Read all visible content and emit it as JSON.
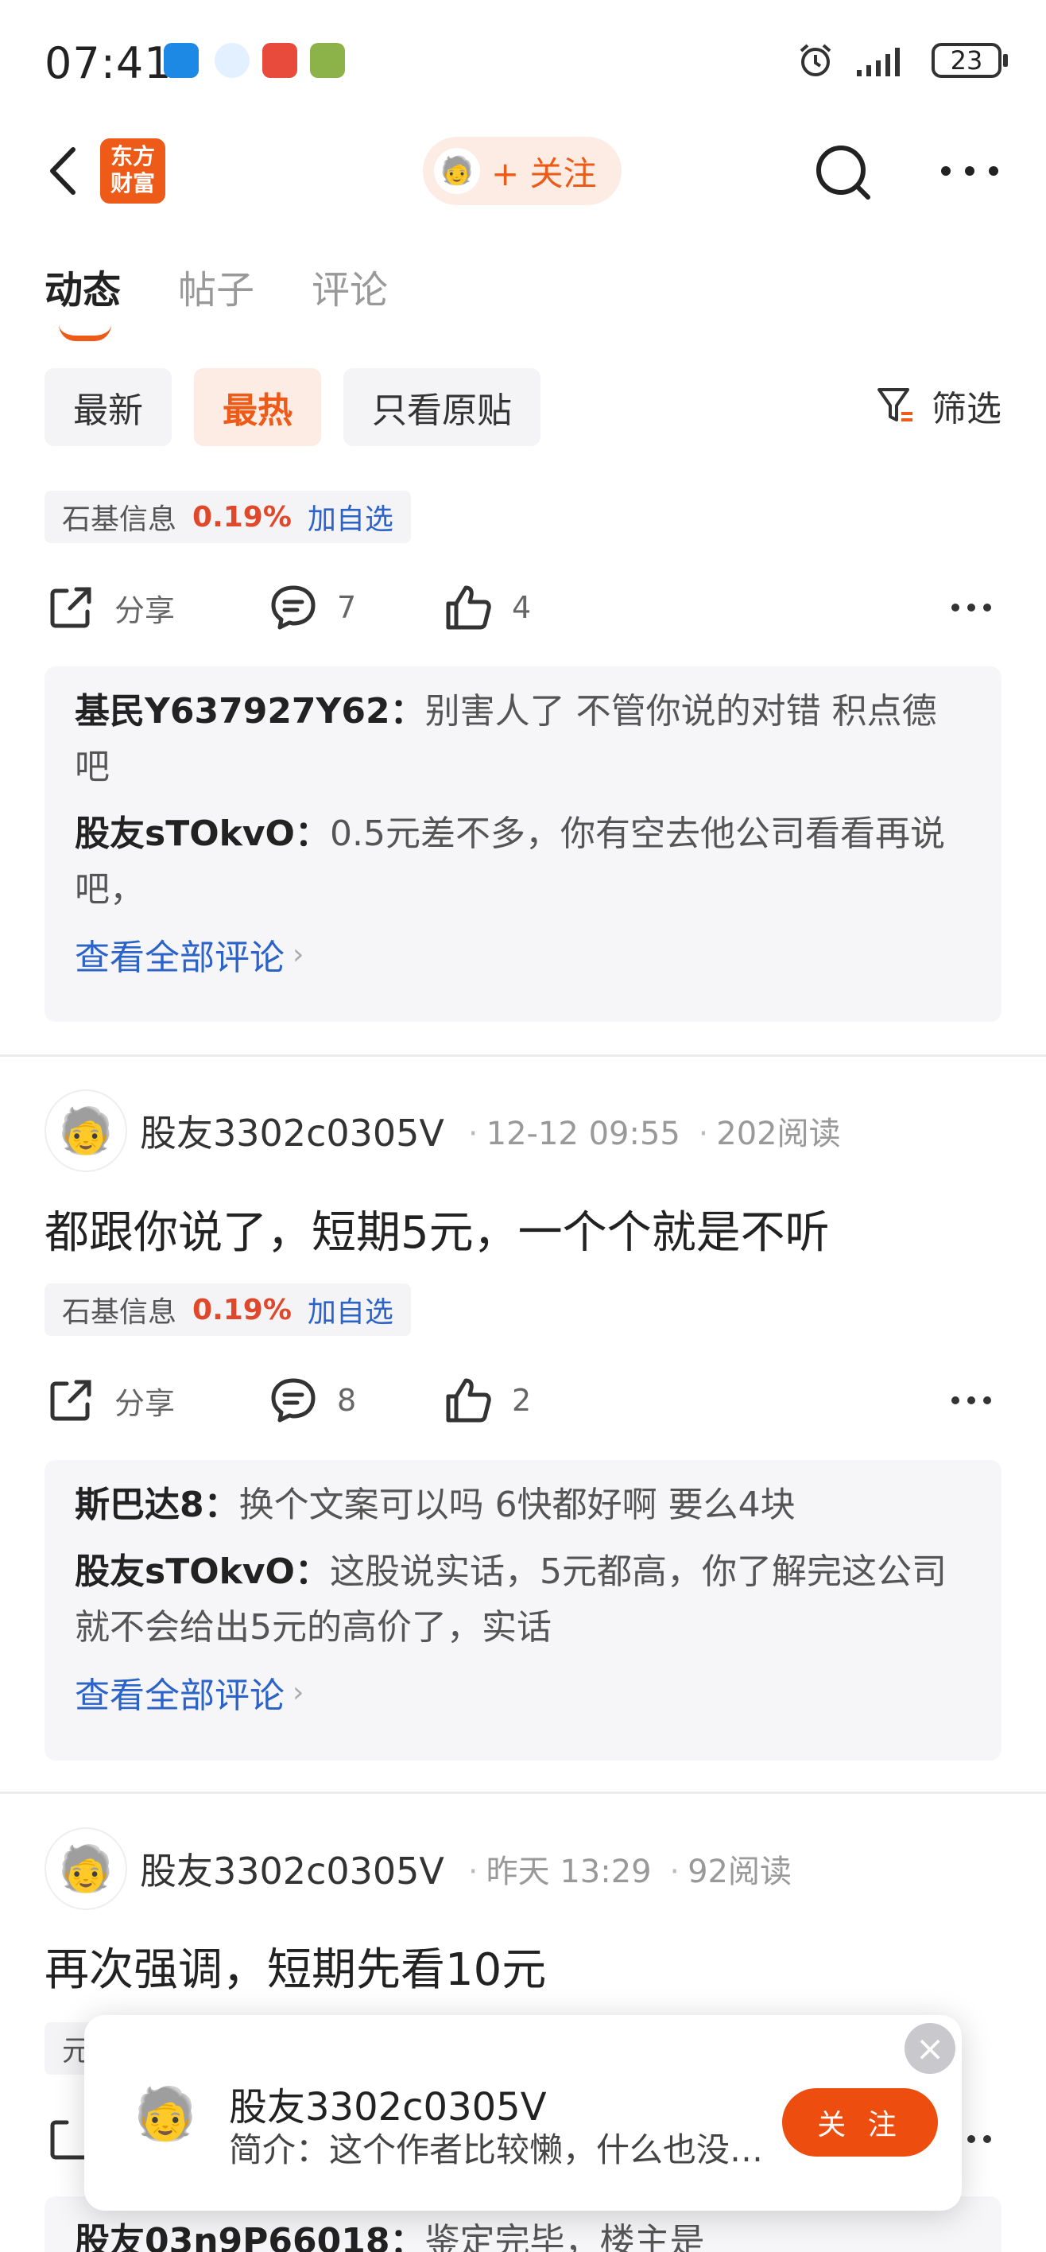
{
  "status_bar": {
    "time": "07:41",
    "battery": "23"
  },
  "nav": {
    "logo_text_1": "东方",
    "logo_text_2": "财富",
    "follow_label": "+ 关注"
  },
  "tabs": [
    {
      "label": "动态"
    },
    {
      "label": "帖子"
    },
    {
      "label": "评论"
    }
  ],
  "filters": {
    "items": [
      "最新",
      "最热",
      "只看原贴"
    ],
    "active": "最热",
    "filter_label": "筛选"
  },
  "posts": [
    {
      "stock": {
        "name": "石基信息",
        "change": "0.19%",
        "add": "加自选"
      },
      "actions": {
        "share": "分享",
        "comments": "7",
        "likes": "4"
      },
      "comments": [
        {
          "user": "基民Y637927Y62：",
          "text": "别害人了 不管你说的对错 积点德吧"
        },
        {
          "user": "股友sTOkvO：",
          "text": "0.5元差不多，你有空去他公司看看再说吧，"
        }
      ],
      "see_all": "查看全部评论"
    },
    {
      "author": "股友3302c0305V",
      "time": "12-12 09:55",
      "reads": "202阅读",
      "title": "都跟你说了，短期5元，一个个就是不听",
      "stock": {
        "name": "石基信息",
        "change": "0.19%",
        "add": "加自选"
      },
      "actions": {
        "share": "分享",
        "comments": "8",
        "likes": "2"
      },
      "comments": [
        {
          "user": "斯巴达8：",
          "text": "换个文案可以吗 6快都好啊 要么4块"
        },
        {
          "user": "股友sTOkvO：",
          "text": "这股说实话，5元都高，你了解完这公司就不会给出5元的高价了，实话"
        }
      ],
      "see_all": "查看全部评论"
    },
    {
      "author": "股友3302c0305V",
      "time": "昨天 13:29",
      "reads": "92阅读",
      "title": "再次强调，短期先看10元",
      "stock_partial": "元",
      "comment_partial": {
        "user": "股友03n9P66018：",
        "text": "鉴定完毕，楼主是"
      }
    }
  ],
  "popup": {
    "name": "股友3302c0305V",
    "desc": "简介：这个作者比较懒，什么也没有留下",
    "follow": "关 注",
    "close": "×"
  },
  "colors": {
    "accent": "#ee5a17",
    "link": "#2b63c8",
    "up": "#e0482b"
  }
}
